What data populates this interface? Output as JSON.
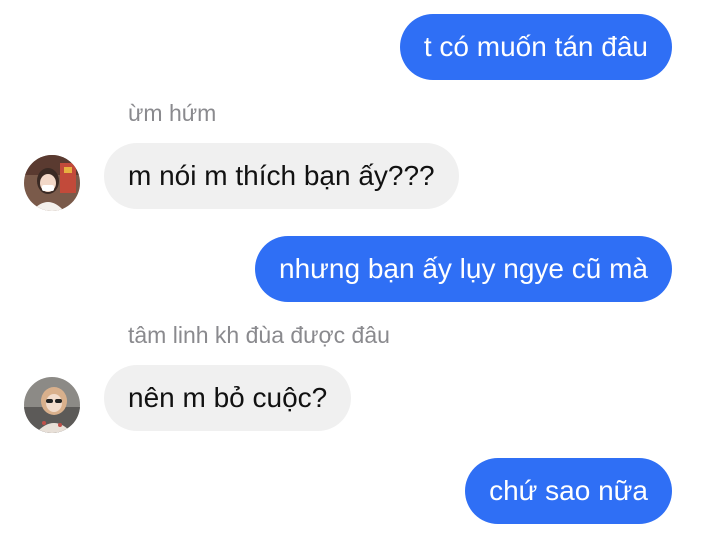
{
  "conversation": {
    "messages": [
      {
        "sender": "me",
        "text": "t có muốn tán đâu"
      },
      {
        "sender": "them",
        "reply_to": "ừm hứm",
        "text": "m nói m thích bạn ấy???"
      },
      {
        "sender": "me",
        "text": "nhưng bạn ấy lụy ngye cũ mà"
      },
      {
        "sender": "them",
        "reply_to": "tâm linh kh đùa được đâu",
        "text": "nên m bỏ cuộc?"
      },
      {
        "sender": "me",
        "text": "chứ sao nữa"
      }
    ]
  },
  "colors": {
    "outgoing_bubble": "#2f6ff5",
    "incoming_bubble": "#f0f0f0",
    "reply_context_text": "#8a8a8e"
  }
}
